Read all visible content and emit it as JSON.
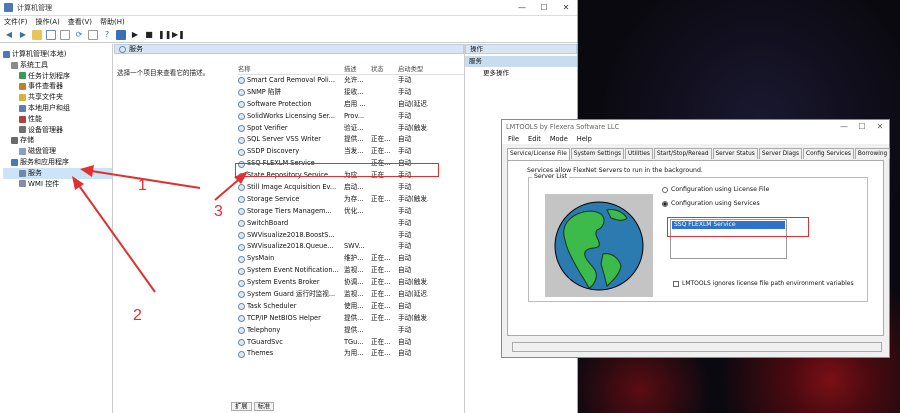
{
  "computer_management": {
    "title": "计算机管理",
    "window_controls": [
      "—",
      "☐",
      "✕"
    ],
    "menu": [
      "文件(F)",
      "操作(A)",
      "查看(V)",
      "帮助(H)"
    ],
    "tree": [
      {
        "label": "计算机管理(本地)",
        "indent": 0,
        "icon": "computer-icon"
      },
      {
        "label": "系统工具",
        "indent": 1,
        "icon": "tools-icon"
      },
      {
        "label": "任务计划程序",
        "indent": 2,
        "icon": "clock-icon"
      },
      {
        "label": "事件查看器",
        "indent": 2,
        "icon": "log-icon"
      },
      {
        "label": "共享文件夹",
        "indent": 2,
        "icon": "folder-icon"
      },
      {
        "label": "本地用户和组",
        "indent": 2,
        "icon": "users-icon"
      },
      {
        "label": "性能",
        "indent": 2,
        "icon": "performance-icon"
      },
      {
        "label": "设备管理器",
        "indent": 2,
        "icon": "device-icon"
      },
      {
        "label": "存储",
        "indent": 1,
        "icon": "storage-icon"
      },
      {
        "label": "磁盘管理",
        "indent": 2,
        "icon": "disk-icon"
      },
      {
        "label": "服务和应用程序",
        "indent": 1,
        "icon": "services-icon"
      },
      {
        "label": "服务",
        "indent": 2,
        "icon": "gear-icon",
        "selected": true
      },
      {
        "label": "WMI 控件",
        "indent": 2,
        "icon": "wmi-icon"
      }
    ],
    "center_header": "服务",
    "center_description": "选择一个项目来查看它的描述。",
    "columns": [
      "名称",
      "描述",
      "状态",
      "启动类型"
    ],
    "services": [
      [
        "Smart Card Removal Poli...",
        "允许...",
        "",
        "手动"
      ],
      [
        "SNMP 陷阱",
        "接收...",
        "",
        "手动"
      ],
      [
        "Software Protection",
        "启用 ...",
        "",
        "自动(延迟..."
      ],
      [
        "SolidWorks Licensing Ser...",
        "Prov...",
        "",
        "手动"
      ],
      [
        "Spot Verifier",
        "验证...",
        "",
        "手动(触发..."
      ],
      [
        "SQL Server VSS Writer",
        "提供...",
        "正在...",
        "自动"
      ],
      [
        "SSDP Discovery",
        "当发...",
        "正在...",
        "手动"
      ],
      [
        "SSQ FLEXLM Service",
        "",
        "正在...",
        "自动"
      ],
      [
        "State Repository Service",
        "为应...",
        "正在...",
        "手动"
      ],
      [
        "Still Image Acquisition Ev...",
        "启动...",
        "",
        "手动"
      ],
      [
        "Storage Service",
        "为存...",
        "正在...",
        "手动(触发..."
      ],
      [
        "Storage Tiers Managem...",
        "优化...",
        "",
        "手动"
      ],
      [
        "SwitchBoard",
        "",
        "",
        "手动"
      ],
      [
        "SWVisualize2018.BoostS...",
        "",
        "",
        "手动"
      ],
      [
        "SWVisualize2018.Queue...",
        "SWV...",
        "",
        "手动"
      ],
      [
        "SysMain",
        "维护...",
        "正在...",
        "自动"
      ],
      [
        "System Event Notification...",
        "监视...",
        "正在...",
        "自动"
      ],
      [
        "System Events Broker",
        "协调...",
        "正在...",
        "自动(触发..."
      ],
      [
        "System Guard 运行时监视...",
        "监视...",
        "正在...",
        "自动(延迟..."
      ],
      [
        "Task Scheduler",
        "使用...",
        "正在...",
        "自动"
      ],
      [
        "TCP/IP NetBIOS Helper",
        "提供...",
        "正在...",
        "手动(触发..."
      ],
      [
        "Telephony",
        "提供...",
        "",
        "手动"
      ],
      [
        "TGuardSvc",
        "TGu...",
        "正在...",
        "自动"
      ],
      [
        "Themes",
        "为用...",
        "正在...",
        "自动"
      ]
    ],
    "bottom_tabs": [
      "扩展",
      "标准"
    ],
    "actions_header": "操作",
    "actions_sub": "服务",
    "actions_item": "更多操作"
  },
  "lmtools": {
    "title": "LMTOOLS by Flexera Software LLC",
    "window_controls": [
      "—",
      "☐",
      "✕"
    ],
    "menu": [
      "File",
      "Edit",
      "Mode",
      "Help"
    ],
    "tabs": [
      "Service/License File",
      "System Settings",
      "Utilities",
      "Start/Stop/Reread",
      "Server Status",
      "Server Diags",
      "Config Services",
      "Borrowing"
    ],
    "intro": "Services allow FlexNet Servers to run in the background.",
    "group_label": "Server List",
    "radio_license": "Configuration using License File",
    "radio_services": "Configuration using Services",
    "service_item": "SSQ FLEXLM Service",
    "checkbox_label": "LMTOOLS ignores license file path environment variables"
  },
  "annotations": {
    "labels": [
      "1",
      "2",
      "3"
    ],
    "color": "#e03030"
  }
}
